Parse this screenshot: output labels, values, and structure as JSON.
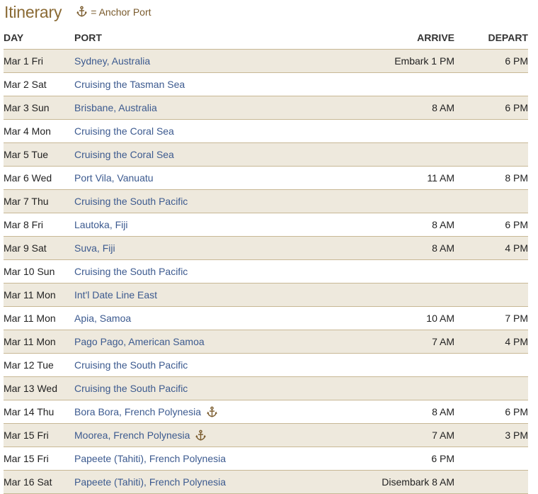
{
  "header": {
    "title": "Itinerary",
    "legend_text": "= Anchor Port",
    "legend_icon": "anchor-icon"
  },
  "colors": {
    "title": "#8a6a34",
    "link": "#3c5a8f",
    "shaded_row": "#eee9dd",
    "divider": "#c8b895"
  },
  "table": {
    "columns": {
      "day": "DAY",
      "port": "PORT",
      "arrive": "ARRIVE",
      "depart": "DEPART"
    },
    "rows": [
      {
        "day": "Mar 1 Fri",
        "port": "Sydney, Australia",
        "arrive": "Embark 1 PM",
        "depart": "6 PM",
        "anchor": false,
        "shaded": true
      },
      {
        "day": "Mar 2 Sat",
        "port": "Cruising the Tasman Sea",
        "arrive": "",
        "depart": "",
        "anchor": false,
        "shaded": false
      },
      {
        "day": "Mar 3 Sun",
        "port": "Brisbane, Australia",
        "arrive": "8 AM",
        "depart": "6 PM",
        "anchor": false,
        "shaded": true
      },
      {
        "day": "Mar 4 Mon",
        "port": "Cruising the Coral Sea",
        "arrive": "",
        "depart": "",
        "anchor": false,
        "shaded": false
      },
      {
        "day": "Mar 5 Tue",
        "port": "Cruising the Coral Sea",
        "arrive": "",
        "depart": "",
        "anchor": false,
        "shaded": true
      },
      {
        "day": "Mar 6 Wed",
        "port": "Port Vila, Vanuatu",
        "arrive": "11 AM",
        "depart": "8 PM",
        "anchor": false,
        "shaded": false
      },
      {
        "day": "Mar 7 Thu",
        "port": "Cruising the South Pacific",
        "arrive": "",
        "depart": "",
        "anchor": false,
        "shaded": true
      },
      {
        "day": "Mar 8 Fri",
        "port": "Lautoka, Fiji",
        "arrive": "8 AM",
        "depart": "6 PM",
        "anchor": false,
        "shaded": false
      },
      {
        "day": "Mar 9 Sat",
        "port": "Suva, Fiji",
        "arrive": "8 AM",
        "depart": "4 PM",
        "anchor": false,
        "shaded": true
      },
      {
        "day": "Mar 10 Sun",
        "port": "Cruising the South Pacific",
        "arrive": "",
        "depart": "",
        "anchor": false,
        "shaded": false
      },
      {
        "day": "Mar 11 Mon",
        "port": "Int'l Date Line East",
        "arrive": "",
        "depart": "",
        "anchor": false,
        "shaded": true
      },
      {
        "day": "Mar 11 Mon",
        "port": "Apia, Samoa",
        "arrive": "10 AM",
        "depart": "7 PM",
        "anchor": false,
        "shaded": false
      },
      {
        "day": "Mar 11 Mon",
        "port": "Pago Pago, American Samoa",
        "arrive": "7 AM",
        "depart": "4 PM",
        "anchor": false,
        "shaded": true
      },
      {
        "day": "Mar 12 Tue",
        "port": "Cruising the South Pacific",
        "arrive": "",
        "depart": "",
        "anchor": false,
        "shaded": false
      },
      {
        "day": "Mar 13 Wed",
        "port": "Cruising the South Pacific",
        "arrive": "",
        "depart": "",
        "anchor": false,
        "shaded": true
      },
      {
        "day": "Mar 14 Thu",
        "port": "Bora Bora, French Polynesia",
        "arrive": "8 AM",
        "depart": "6 PM",
        "anchor": true,
        "shaded": false
      },
      {
        "day": "Mar 15 Fri",
        "port": "Moorea, French Polynesia",
        "arrive": "7 AM",
        "depart": "3 PM",
        "anchor": true,
        "shaded": true
      },
      {
        "day": "Mar 15 Fri",
        "port": "Papeete (Tahiti), French Polynesia",
        "arrive": "6 PM",
        "depart": "",
        "anchor": false,
        "shaded": false
      },
      {
        "day": "Mar 16 Sat",
        "port": "Papeete (Tahiti), French Polynesia",
        "arrive": "Disembark 8 AM",
        "depart": "",
        "anchor": false,
        "shaded": true
      }
    ]
  }
}
